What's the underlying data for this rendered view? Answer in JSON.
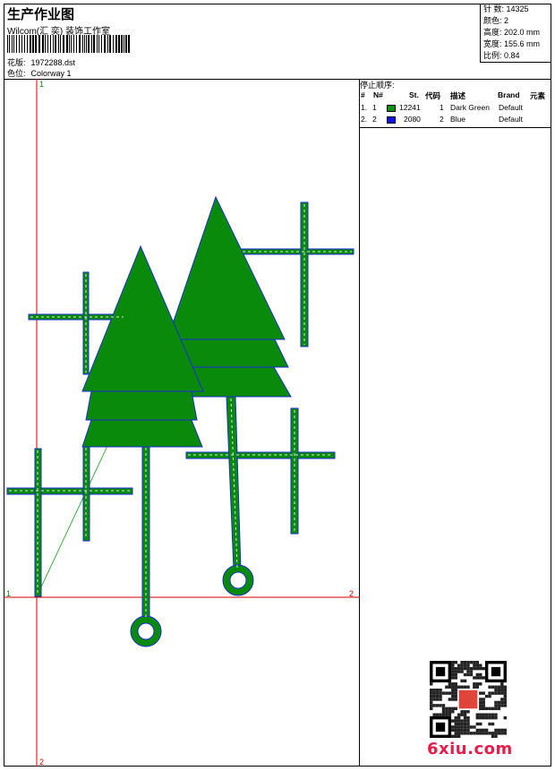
{
  "header": {
    "title": "生产作业图",
    "company": "Wilcom(汇 奕) 装饰工作室",
    "design_label": "花版:",
    "design_value": "1972288.dst",
    "colorway_label": "色位:",
    "colorway_value": "Colorway 1"
  },
  "stats": {
    "stitches": "针 数: 14325",
    "colors": "颜色: 2",
    "height": "高度: 202.0 mm",
    "width": "宽度: 155.6 mm",
    "scale": "比例: 0.84"
  },
  "stop_sequence": {
    "heading": "停止顺序:",
    "columns": [
      "#",
      "N#",
      "St.",
      "代码",
      "描述",
      "Brand",
      "元素"
    ],
    "rows": [
      {
        "idx": "1.",
        "n": "1",
        "color": "#119011",
        "st": "12241",
        "code": "1",
        "desc": "Dark Green",
        "brand": "Default"
      },
      {
        "idx": "2.",
        "n": "2",
        "color": "#1010e8",
        "st": "2080",
        "code": "2",
        "desc": "Blue",
        "brand": "Default"
      }
    ]
  },
  "axis_labels": {
    "top": "1",
    "left": "1",
    "right": "2",
    "bottom": "2"
  },
  "watermark": "6xiu.com",
  "colors": {
    "guide": "#d00000",
    "fill": "#0a8a0a",
    "outline": "#1a2ed0",
    "stitch": "#ffffff"
  }
}
